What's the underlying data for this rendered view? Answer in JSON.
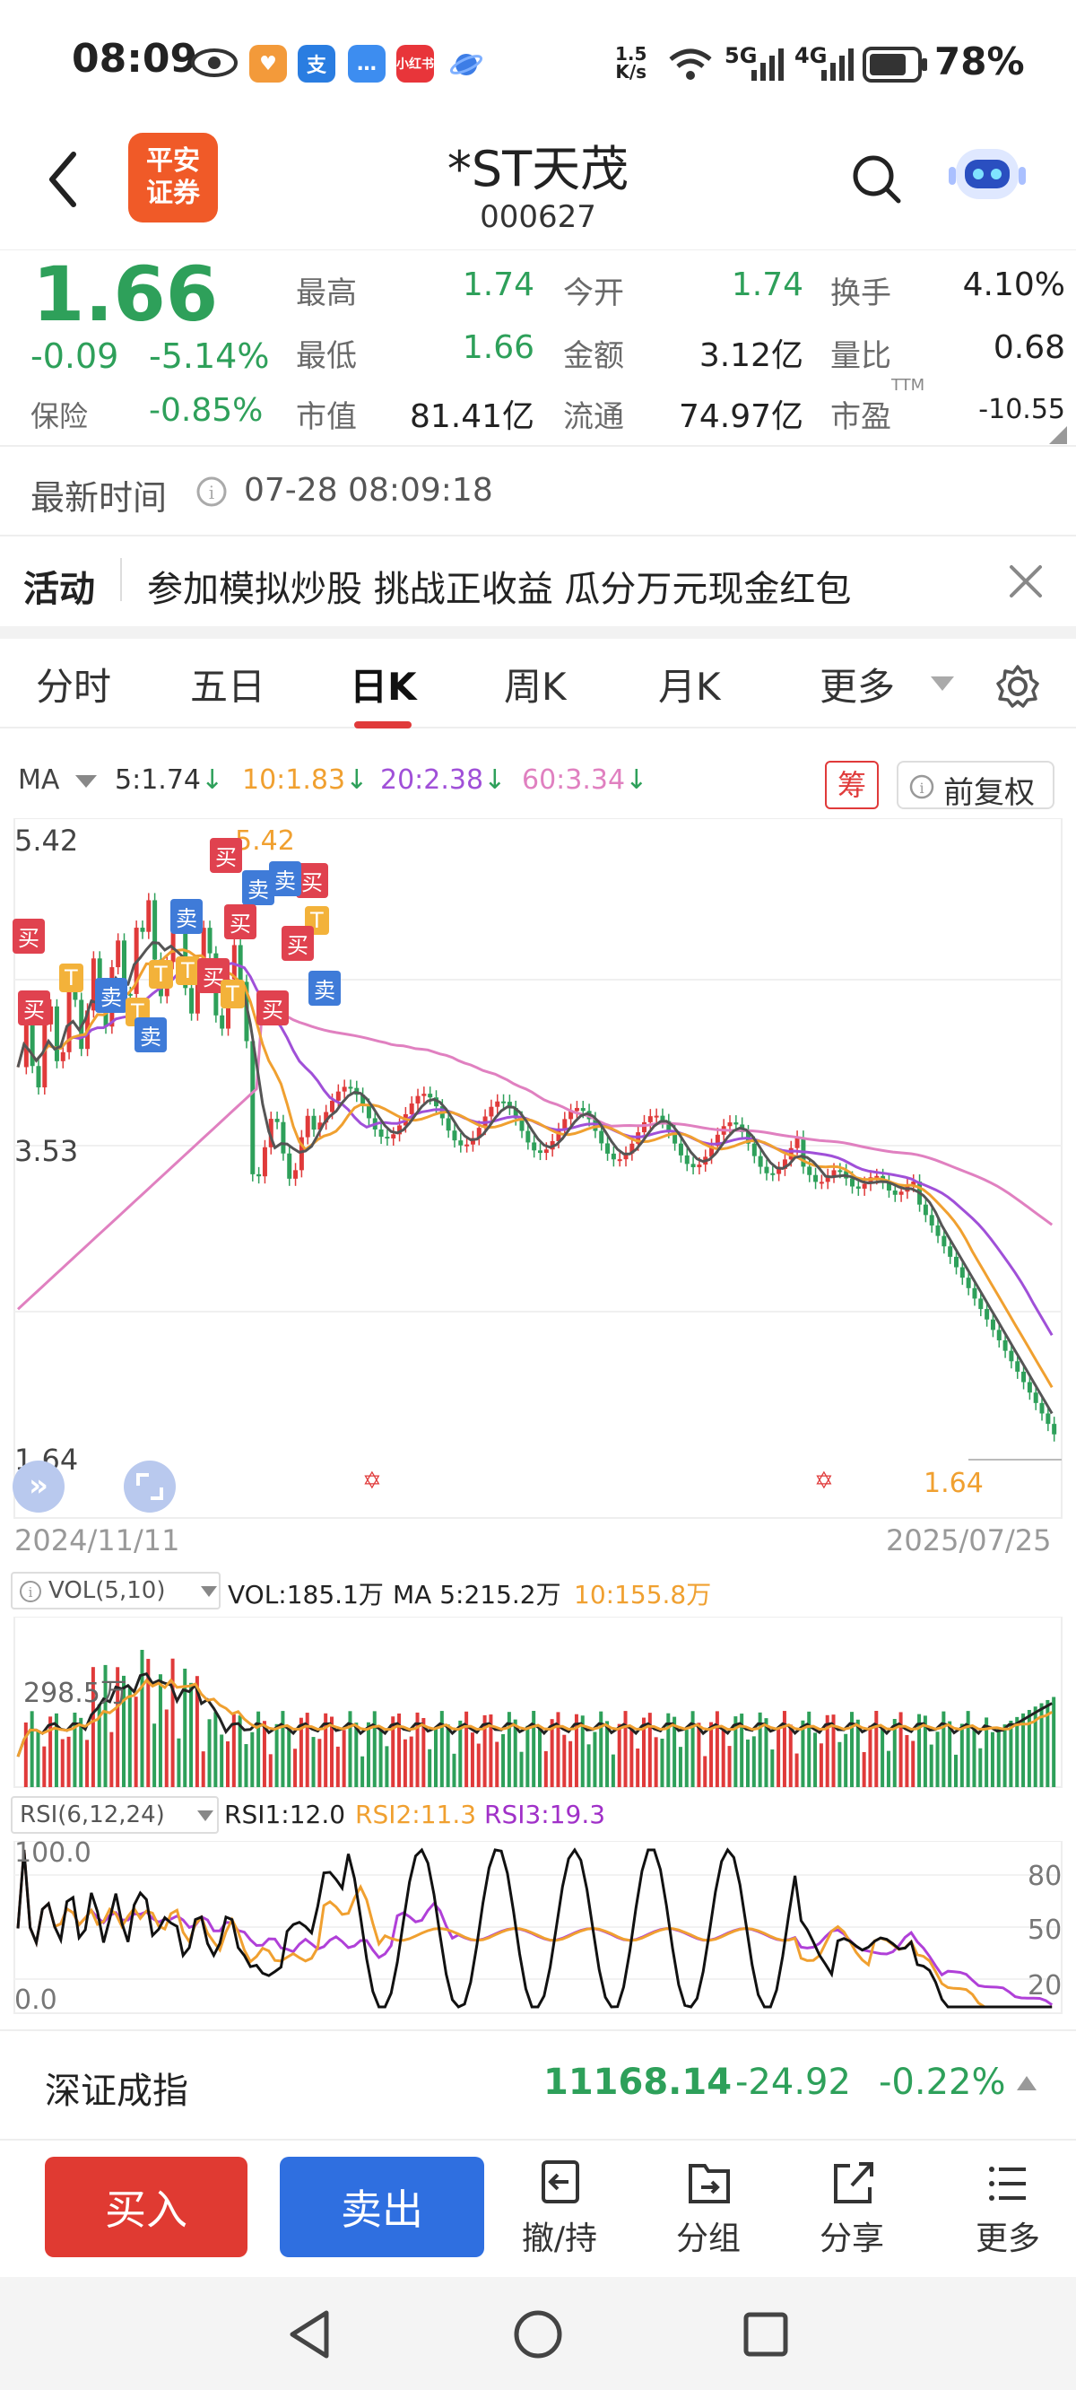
{
  "status_bar": {
    "time": "08:09",
    "net_speed": "1.5\nK/s",
    "net_speed_top": "1.5",
    "net_speed_bottom": "K/s",
    "signal_5g": "5G",
    "signal_4g": "4G",
    "battery": "78%",
    "app_icons": [
      "eye-icon",
      "heart-app-icon",
      "alipay-icon",
      "chat-icon",
      "xiaohongshu-icon",
      "planet-icon"
    ],
    "xhs_label": "小红书",
    "alipay_label": "支"
  },
  "header": {
    "back_icon": "chevron-left-icon",
    "logo_line1": "平安",
    "logo_line2": "证券",
    "title": "*ST天茂",
    "code": "000627",
    "search_icon": "search-icon",
    "assistant_icon": "robot-icon"
  },
  "quote": {
    "price": "1.66",
    "change": "-0.09",
    "change_pct": "-5.14%",
    "sector_label": "保险",
    "sector_pct": "-0.85%",
    "items": {
      "high_label": "最高",
      "high": "1.74",
      "low_label": "最低",
      "low": "1.66",
      "mktcap_label": "市值",
      "mktcap": "81.41亿",
      "open_label": "今开",
      "open": "1.74",
      "amount_label": "金额",
      "amount": "3.12亿",
      "float_label": "流通",
      "float": "74.97亿",
      "turnover_label": "换手",
      "turnover": "4.10%",
      "volratio_label": "量比",
      "volratio": "0.68",
      "pe_label": "市盈",
      "pe_sup": "TTM",
      "pe": "-10.55"
    }
  },
  "latest_time": {
    "label": "最新时间",
    "value": "07-28 08:09:18"
  },
  "activity": {
    "label": "活动",
    "text": "参加模拟炒股 挑战正收益 瓜分万元现金红包",
    "close_icon": "close-icon"
  },
  "tabs": [
    "分时",
    "五日",
    "日K",
    "周K",
    "月K",
    "更多"
  ],
  "active_tab": "日K",
  "settings_icon": "gear-icon",
  "chart": {
    "ma_label": "MA",
    "ma5": "5:1.74",
    "ma10": "10:1.83",
    "ma20": "20:2.38",
    "ma60": "60:3.34",
    "chip_btn": "筹",
    "adjust_btn": "前复权",
    "price_high_label": "5.42",
    "price_high_mark": "5.42",
    "price_mid_label": "3.53",
    "price_low_label": "1.64",
    "price_low_mark": "1.64",
    "date_start": "2024/11/11",
    "date_end": "2025/07/25",
    "vol_selector": "VOL(5,10)",
    "vol_text": "VOL:185.1万",
    "vol_ma5": "MA 5:215.2万",
    "vol_ma10": "10:155.8万",
    "vol_axis": "298.5万",
    "rsi_selector": "RSI(6,12,24)",
    "rsi1": "RSI1:12.0",
    "rsi2": "RSI2:11.3",
    "rsi3": "RSI3:19.3",
    "rsi_top": "100.0",
    "rsi_bottom": "0.0",
    "rsi_80": "80",
    "rsi_50": "50",
    "rsi_20": "20",
    "tag_buy": "买",
    "tag_sell": "卖",
    "tag_t": "T",
    "colors": {
      "up": "#e03a3a",
      "down": "#2ea05a",
      "ma5": "#333333",
      "ma10": "#f0a030",
      "ma20": "#a050d8",
      "ma60": "#e080c0",
      "blue": "#3f7bd8"
    }
  },
  "chart_data": {
    "type": "line",
    "title": "",
    "x_range": [
      "2024/11/11",
      "2025/07/25"
    ],
    "ylim": [
      1.64,
      5.42
    ],
    "series": [
      {
        "name": "5",
        "last": 1.74
      },
      {
        "name": "10",
        "last": 1.83
      },
      {
        "name": "20",
        "last": 2.38
      },
      {
        "name": "60",
        "last": 3.34
      }
    ]
  },
  "index": {
    "name": "深证成指",
    "value": "11168.14",
    "change": "-24.92",
    "change_pct": "-0.22%"
  },
  "actions": {
    "buy": "买入",
    "sell": "卖出",
    "items": [
      {
        "label": "撤/持",
        "icon": "cancel-hold-icon"
      },
      {
        "label": "分组",
        "icon": "group-icon"
      },
      {
        "label": "分享",
        "icon": "share-icon"
      },
      {
        "label": "更多",
        "icon": "menu-icon"
      }
    ]
  }
}
